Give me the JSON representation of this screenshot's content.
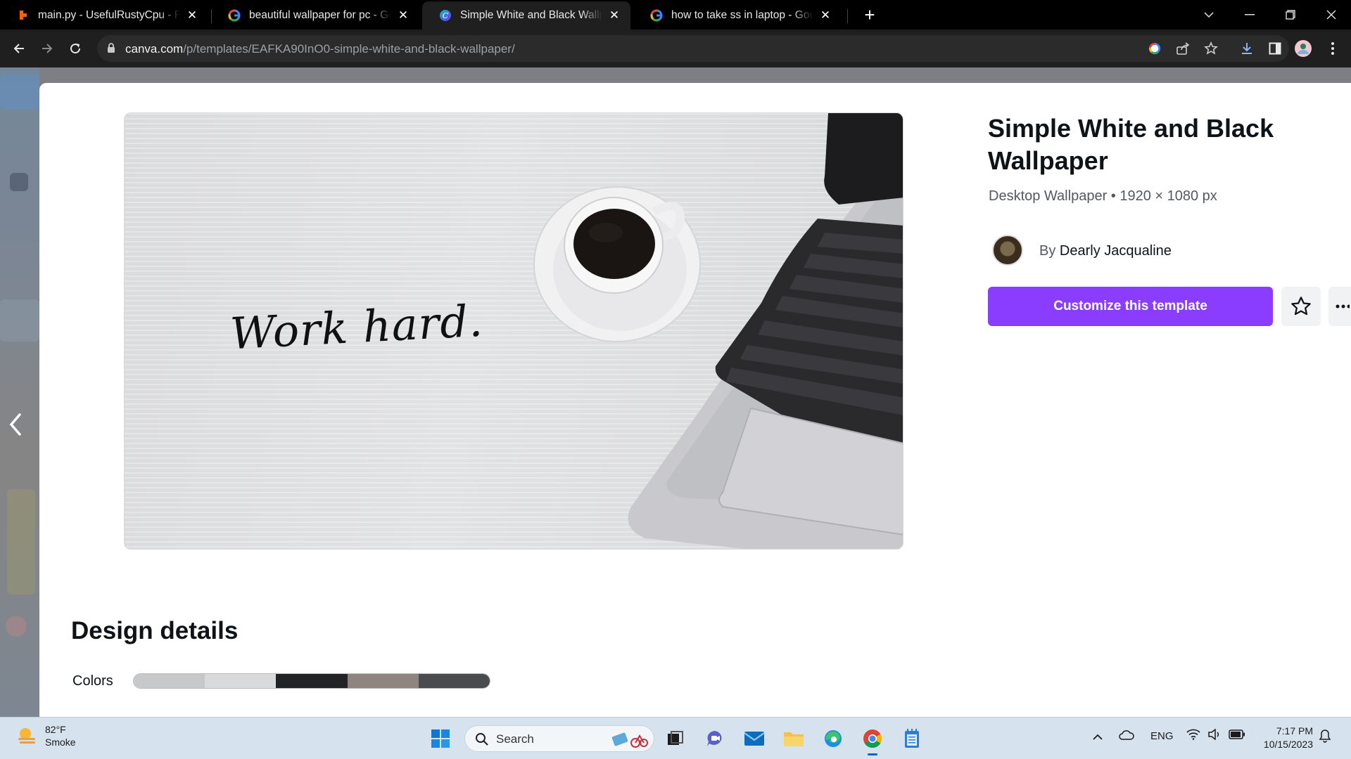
{
  "browser": {
    "tabs": [
      {
        "title": "main.py - UsefulRustyCpu - Repl",
        "favicon": "replit-icon",
        "active": false
      },
      {
        "title": "beautiful wallpaper for pc - Goo",
        "favicon": "google-icon",
        "active": false
      },
      {
        "title": "Simple White and Black Wallpap",
        "favicon": "canva-icon",
        "active": true
      },
      {
        "title": "how to take ss in laptop - Googl",
        "favicon": "google-icon",
        "active": false
      }
    ],
    "url": {
      "host": "canva.com",
      "path": "/p/templates/EAFKA90InO0-simple-white-and-black-wallpaper/"
    }
  },
  "template": {
    "preview_text": "Work hard.",
    "title": "Simple White and Black Wallpaper",
    "meta": "Desktop Wallpaper • 1920 × 1080 px",
    "by_prefix": "By",
    "author": "Dearly Jacqualine",
    "cta_label": "Customize this template"
  },
  "design_details": {
    "heading": "Design details",
    "colors_label": "Colors",
    "colors": [
      "#c7c8ca",
      "#d9dadc",
      "#222326",
      "#8e8581",
      "#4a4b4e"
    ]
  },
  "taskbar": {
    "weather_temp": "82°F",
    "weather_desc": "Smoke",
    "search_placeholder": "Search",
    "language": "ENG",
    "time": "7:17 PM",
    "date": "10/15/2023"
  },
  "colors": {
    "accent": "#8b3dff",
    "tab_strip": "#000000",
    "toolbar": "#1f1f1f"
  }
}
